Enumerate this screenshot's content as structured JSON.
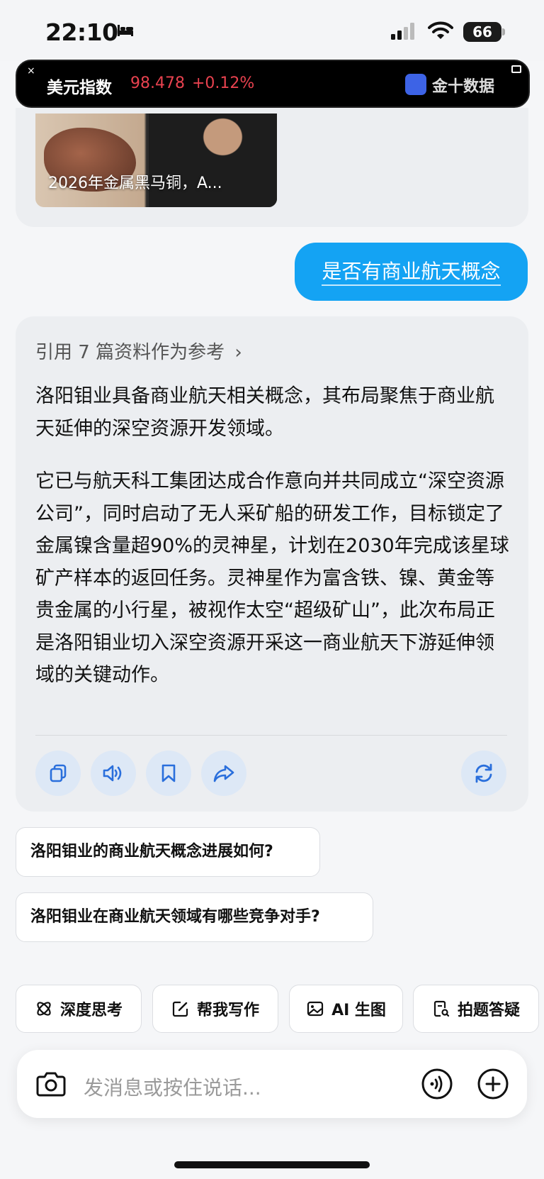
{
  "status": {
    "time": "22:10",
    "battery": "66"
  },
  "ticker": {
    "name": "美元指数",
    "value": "98.478",
    "change": "+0.12%",
    "brand": "金十数据",
    "close_glyph": "×"
  },
  "prev_card": {
    "caption": "2026年金属黑马铜，A..."
  },
  "user_message": "是否有商业航天概念",
  "answer": {
    "reference": "引用 7 篇资料作为参考",
    "chevron": "›",
    "paragraph1": "洛阳钼业具备商业航天相关概念，其布局聚焦于商业航天延伸的深空资源开发领域。",
    "paragraph2": "它已与航天科工集团达成合作意向并共同成立“深空资源公司”，同时启动了无人采矿船的研发工作，目标锁定了金属镍含量超90%的灵神星，计划在2030年完成该星球矿产样本的返回任务。灵神星作为富含铁、镍、黄金等贵金属的小行星，被视作太空“超级矿山”，此次布局正是洛阳钼业切入深空资源开采这一商业航天下游延伸领域的关键动作。"
  },
  "suggestions": [
    "洛阳钼业的商业航天概念进展如何?",
    "洛阳钼业在商业航天领域有哪些竞争对手?"
  ],
  "tools": [
    {
      "label": "深度思考",
      "icon": "atom-icon"
    },
    {
      "label": "帮我写作",
      "icon": "edit-icon"
    },
    {
      "label": "AI 生图",
      "icon": "image-icon"
    },
    {
      "label": "拍题答疑",
      "icon": "doc-search-icon"
    }
  ],
  "input": {
    "placeholder": "发消息或按住说话..."
  },
  "colors": {
    "accent": "#14a3f3",
    "ticker_red": "#e8424f",
    "action_blue": "#2a6fdc"
  }
}
